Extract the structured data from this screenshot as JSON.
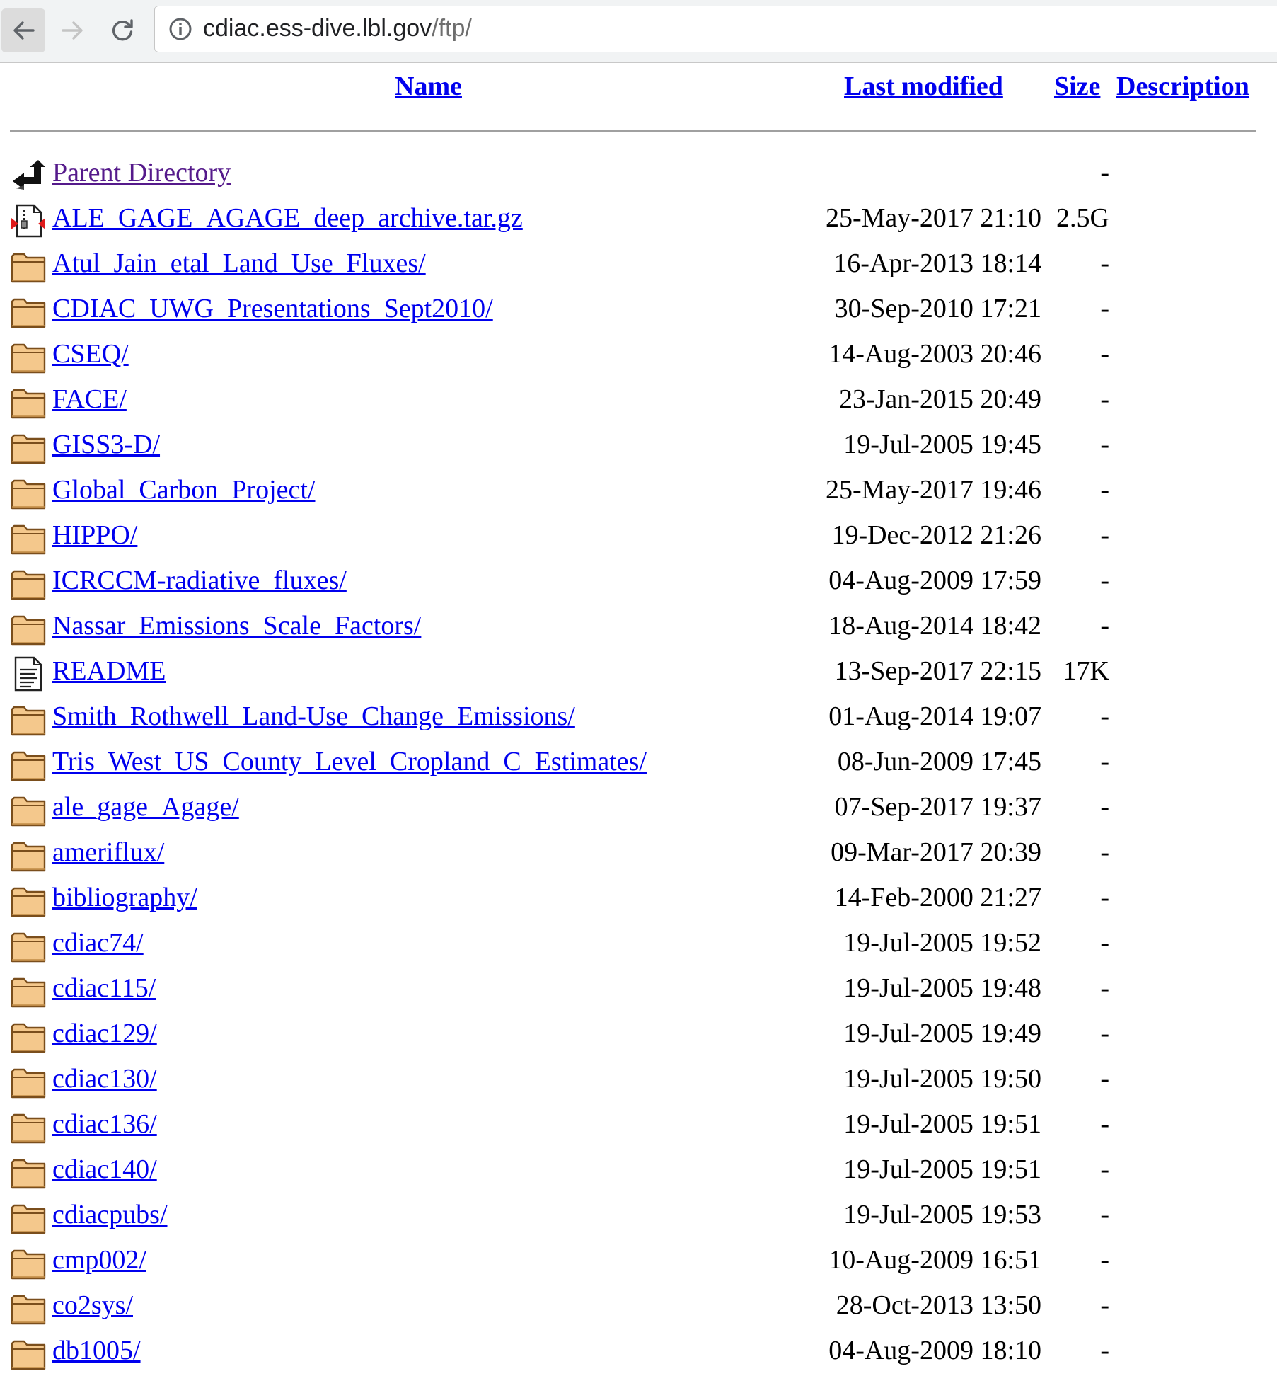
{
  "browser": {
    "url_host": "cdiac.ess-dive.lbl.gov",
    "url_path": "/ftp/"
  },
  "columns": {
    "name": "Name",
    "last_modified": "Last modified",
    "size": "Size",
    "description": "Description"
  },
  "entries": [
    {
      "icon": "back-icon",
      "name": "Parent Directory",
      "modified": "",
      "size": "-"
    },
    {
      "icon": "archive-icon",
      "name": "ALE_GAGE_AGAGE_deep_archive.tar.gz",
      "modified": "25-May-2017 21:10",
      "size": "2.5G"
    },
    {
      "icon": "folder-icon",
      "name": "Atul_Jain_etal_Land_Use_Fluxes/",
      "modified": "16-Apr-2013 18:14",
      "size": "-"
    },
    {
      "icon": "folder-icon",
      "name": "CDIAC_UWG_Presentations_Sept2010/",
      "modified": "30-Sep-2010 17:21",
      "size": "-"
    },
    {
      "icon": "folder-icon",
      "name": "CSEQ/",
      "modified": "14-Aug-2003 20:46",
      "size": "-"
    },
    {
      "icon": "folder-icon",
      "name": "FACE/",
      "modified": "23-Jan-2015 20:49",
      "size": "-"
    },
    {
      "icon": "folder-icon",
      "name": "GISS3-D/",
      "modified": "19-Jul-2005 19:45",
      "size": "-"
    },
    {
      "icon": "folder-icon",
      "name": "Global_Carbon_Project/",
      "modified": "25-May-2017 19:46",
      "size": "-"
    },
    {
      "icon": "folder-icon",
      "name": "HIPPO/",
      "modified": "19-Dec-2012 21:26",
      "size": "-"
    },
    {
      "icon": "folder-icon",
      "name": "ICRCCM-radiative_fluxes/",
      "modified": "04-Aug-2009 17:59",
      "size": "-"
    },
    {
      "icon": "folder-icon",
      "name": "Nassar_Emissions_Scale_Factors/",
      "modified": "18-Aug-2014 18:42",
      "size": "-"
    },
    {
      "icon": "text-file-icon",
      "name": "README",
      "modified": "13-Sep-2017 22:15",
      "size": "17K"
    },
    {
      "icon": "folder-icon",
      "name": "Smith_Rothwell_Land-Use_Change_Emissions/",
      "modified": "01-Aug-2014 19:07",
      "size": "-"
    },
    {
      "icon": "folder-icon",
      "name": "Tris_West_US_County_Level_Cropland_C_Estimates/",
      "modified": "08-Jun-2009 17:45",
      "size": "-"
    },
    {
      "icon": "folder-icon",
      "name": "ale_gage_Agage/",
      "modified": "07-Sep-2017 19:37",
      "size": "-"
    },
    {
      "icon": "folder-icon",
      "name": "ameriflux/",
      "modified": "09-Mar-2017 20:39",
      "size": "-"
    },
    {
      "icon": "folder-icon",
      "name": "bibliography/",
      "modified": "14-Feb-2000 21:27",
      "size": "-"
    },
    {
      "icon": "folder-icon",
      "name": "cdiac74/",
      "modified": "19-Jul-2005 19:52",
      "size": "-"
    },
    {
      "icon": "folder-icon",
      "name": "cdiac115/",
      "modified": "19-Jul-2005 19:48",
      "size": "-"
    },
    {
      "icon": "folder-icon",
      "name": "cdiac129/",
      "modified": "19-Jul-2005 19:49",
      "size": "-"
    },
    {
      "icon": "folder-icon",
      "name": "cdiac130/",
      "modified": "19-Jul-2005 19:50",
      "size": "-"
    },
    {
      "icon": "folder-icon",
      "name": "cdiac136/",
      "modified": "19-Jul-2005 19:51",
      "size": "-"
    },
    {
      "icon": "folder-icon",
      "name": "cdiac140/",
      "modified": "19-Jul-2005 19:51",
      "size": "-"
    },
    {
      "icon": "folder-icon",
      "name": "cdiacpubs/",
      "modified": "19-Jul-2005 19:53",
      "size": "-"
    },
    {
      "icon": "folder-icon",
      "name": "cmp002/",
      "modified": "10-Aug-2009 16:51",
      "size": "-"
    },
    {
      "icon": "folder-icon",
      "name": "co2sys/",
      "modified": "28-Oct-2013 13:50",
      "size": "-"
    },
    {
      "icon": "folder-icon",
      "name": "db1005/",
      "modified": "04-Aug-2009 18:10",
      "size": "-"
    }
  ],
  "colors": {
    "link": "#0000ee",
    "visited_link": "#551a8b",
    "folder_fill": "#f4c88c",
    "folder_stroke": "#7a4e1c"
  }
}
